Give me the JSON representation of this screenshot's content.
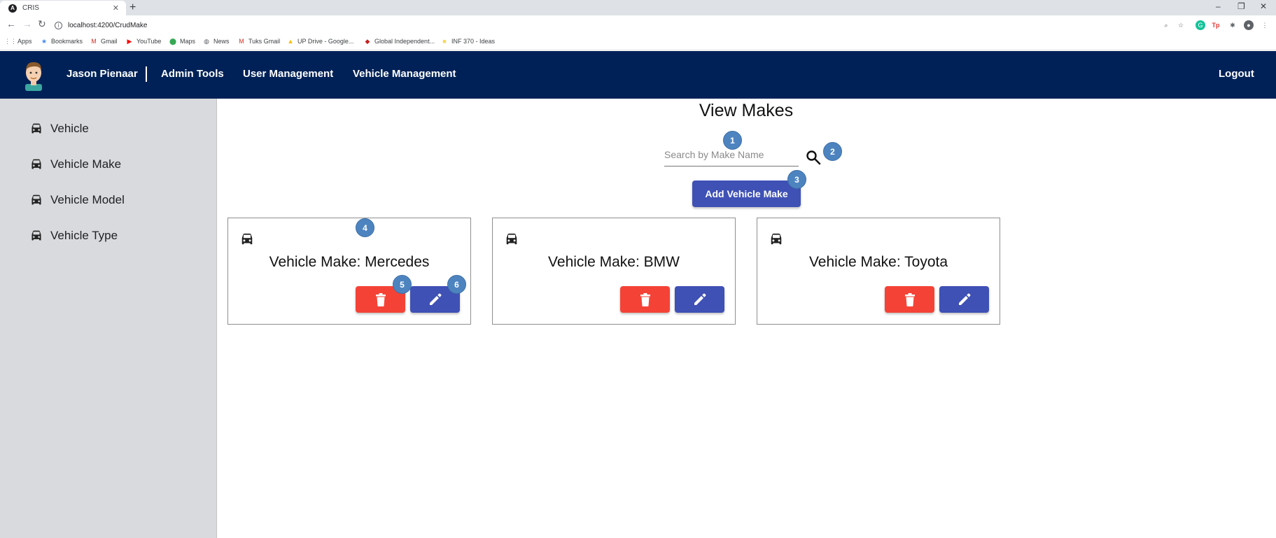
{
  "browser": {
    "tab_title": "CRIS",
    "url": "localhost:4200/CrudMake",
    "bookmarks": [
      {
        "label": "Apps",
        "icon": "apps-grid-icon",
        "color": "#4285f4"
      },
      {
        "label": "Bookmarks",
        "icon": "star-icon",
        "color": "#4285f4"
      },
      {
        "label": "Gmail",
        "icon": "gmail-icon",
        "color": "#d93025"
      },
      {
        "label": "YouTube",
        "icon": "youtube-icon",
        "color": "#ff0000"
      },
      {
        "label": "Maps",
        "icon": "maps-pin-icon",
        "color": "#34a853"
      },
      {
        "label": "News",
        "icon": "globe-icon",
        "color": "#5f6368"
      },
      {
        "label": "Tuks Gmail",
        "icon": "gmail-icon",
        "color": "#d93025"
      },
      {
        "label": "UP Drive - Google...",
        "icon": "drive-icon",
        "color": "#fbbc04"
      },
      {
        "label": "Global Independent...",
        "icon": "link-icon",
        "color": "#c5221f"
      },
      {
        "label": "INF 370 - Ideas",
        "icon": "folder-icon",
        "color": "#f9d65c"
      }
    ]
  },
  "navbar": {
    "user_name": "Jason Pienaar",
    "links": [
      "Admin Tools",
      "User Management",
      "Vehicle Management"
    ],
    "logout": "Logout",
    "background": "#002157"
  },
  "sidebar": {
    "items": [
      {
        "label": "Vehicle",
        "icon": "car-icon"
      },
      {
        "label": "Vehicle Make",
        "icon": "car-icon"
      },
      {
        "label": "Vehicle Model",
        "icon": "car-icon"
      },
      {
        "label": "Vehicle Type",
        "icon": "car-icon"
      }
    ]
  },
  "main": {
    "title": "View Makes",
    "search_placeholder": "Search by Make Name",
    "add_button": "Add Vehicle Make",
    "cards": [
      {
        "title": "Vehicle Make: Mercedes"
      },
      {
        "title": "Vehicle Make: BMW"
      },
      {
        "title": "Vehicle Make: Toyota"
      }
    ]
  },
  "markers": [
    "1",
    "2",
    "3",
    "4",
    "5",
    "6"
  ],
  "colors": {
    "primary": "#3f51b5",
    "danger": "#f44336",
    "marker": "#4d84c0"
  }
}
